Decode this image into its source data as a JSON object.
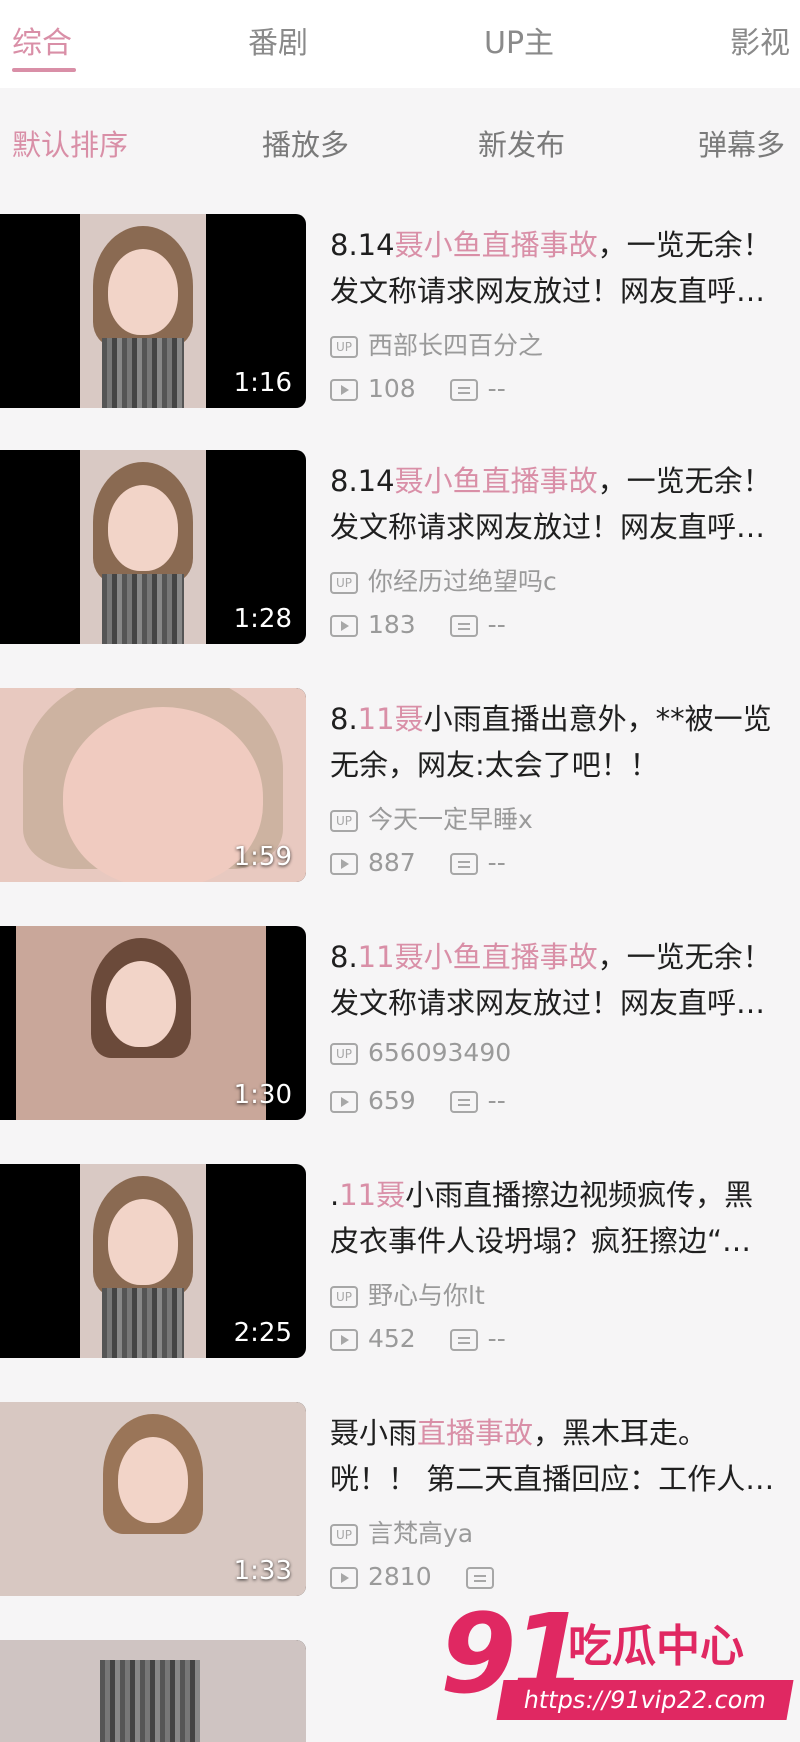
{
  "tabs": {
    "items": [
      "综合",
      "番剧",
      "UP主",
      "影视"
    ],
    "active_index": 0
  },
  "sort": {
    "items": [
      "默认排序",
      "播放多",
      "新发布",
      "弹幕多"
    ],
    "active_index": 0
  },
  "videos": [
    {
      "title_pre": "8.14",
      "title_hl": "聂小鱼直播事故",
      "title_post": "，一览无余！",
      "title_line2": "发文称请求网友放过！网友直呼…",
      "duration": "1:16",
      "uploader": "西部长四百分之",
      "plays": "108",
      "danmaku": "--"
    },
    {
      "title_pre": "8.14",
      "title_hl": "聂小鱼直播事故",
      "title_post": "，一览无余！",
      "title_line2": "发文称请求网友放过！网友直呼…",
      "duration": "1:28",
      "uploader": "你经历过绝望吗c",
      "plays": "183",
      "danmaku": "--"
    },
    {
      "title_pre": "8.",
      "title_hl": "11聂",
      "title_post": "小雨直播出意外，**被一览",
      "title_line2": "无余，网友:太会了吧！！",
      "duration": "1:59",
      "uploader": "今天一定早睡x",
      "plays": "887",
      "danmaku": "--"
    },
    {
      "title_pre": "8.",
      "title_hl": "11聂小鱼直播事故",
      "title_post": "，一览无余！",
      "title_line2": "发文称请求网友放过！网友直呼…",
      "duration": "1:30",
      "uploader": "656093490",
      "plays": "659",
      "danmaku": "--"
    },
    {
      "title_pre": ".",
      "title_hl": "11聂",
      "title_post": "小雨直播擦边视频疯传，黑",
      "title_line2": "皮衣事件人设坍塌？疯狂擦边“…",
      "duration": "2:25",
      "uploader": "野心与你lt",
      "plays": "452",
      "danmaku": "--"
    },
    {
      "title_pre": "聂小雨",
      "title_hl": "直播事故",
      "title_post": "，黑木耳走。",
      "title_line2": "咣！！ 第二天直播回应：工作人…",
      "duration": "1:33",
      "uploader": "言梵高ya",
      "plays": "2810",
      "danmaku": ""
    }
  ],
  "watermark": {
    "number": "91",
    "text": "吃瓜中心",
    "url": "https://91vip22.com"
  },
  "colors": {
    "accent": "#d98fa7",
    "watermark": "#e02862"
  }
}
